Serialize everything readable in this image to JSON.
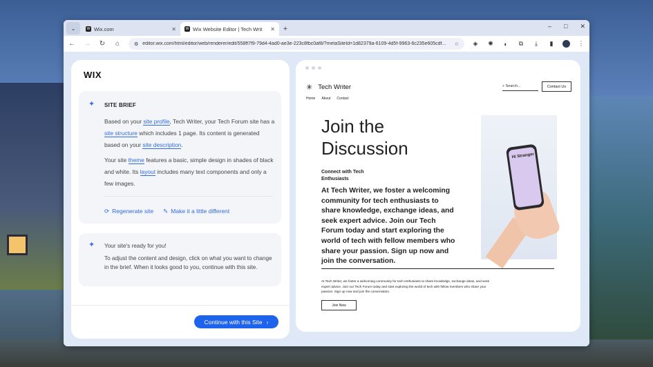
{
  "browser": {
    "tabs": [
      {
        "label": "Wix.com",
        "favicon": "W",
        "active": false
      },
      {
        "label": "Wix Website Editor | Tech Writ",
        "favicon": "W",
        "active": true
      }
    ],
    "new_tab": "+",
    "window_controls": {
      "minimize": "–",
      "maximize": "□",
      "close": "✕"
    },
    "url": "editor.wix.com/html/editor/web/renderer/edit/558ff7f9-79d4-4ad0-ae3e-223c8fbc0af8/?metaSiteId=1d82379a-6109-4d5f-9963-6c235e605cdf..."
  },
  "left_panel": {
    "logo": "WIX",
    "brief": {
      "title": "SITE BRIEF",
      "p1_a": "Based on your ",
      "p1_link1": "site profile",
      "p1_b": ", Tech Writer, your Tech Forum site has a ",
      "p1_link2": "site structure",
      "p1_c": " which includes 1 page. Its content is generated based on your ",
      "p1_link3": "site description",
      "p1_d": ".",
      "p2_a": "Your site ",
      "p2_link1": "theme",
      "p2_b": " features a basic, simple design in shades of black and white. Its ",
      "p2_link2": "layout",
      "p2_c": " includes many text components and only a few images.",
      "regenerate": "Regenerate site",
      "make_different": "Make it a little different"
    },
    "ready": {
      "title": "Your site's ready for you!",
      "body": "To adjust the content and design, click on what you want to change in the brief. When it looks good to you, continue with this site."
    },
    "continue_button": "Continue with this Site"
  },
  "preview": {
    "site_name": "Tech Writer",
    "search_placeholder": "Search...",
    "contact_button": "Contact Us",
    "nav": [
      "Home",
      "About",
      "Contact"
    ],
    "hero_title": "Join the Discussion",
    "hero_subtitle": "Connect with Tech Enthusiasts",
    "hero_body": "At Tech Writer, we foster a welcoming community for tech enthusiasts to share knowledge, exchange ideas, and seek expert advice. Join our Tech Forum today and start exploring the world of tech with fellow members who share your passion. Sign up now and join the conversation.",
    "phone_text": "Hi Stranger",
    "small_text": "At Tech Writer, we foster a welcoming community for tech enthusiasts to share knowledge, exchange ideas, and seek expert advice. Join our Tech Forum today and start exploring the world of tech with fellow members who share your passion. Sign up now and join the conversation.",
    "join_button": "Join Now"
  },
  "colors": {
    "accent": "#1e63ec",
    "link": "#2f6be0"
  }
}
